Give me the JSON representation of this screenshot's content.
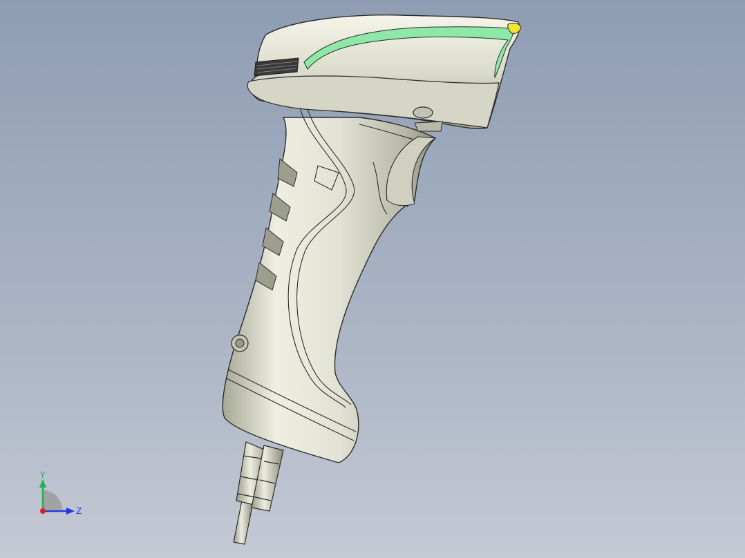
{
  "viewport": {
    "background_top": "#8f9db3",
    "background_bottom": "#c4c9d4"
  },
  "model": {
    "body_color": "#e6e6d8",
    "edge_color": "#2b2b2b",
    "accent_light_color": "#8ee8a8",
    "accent_yellow_color": "#f2e430"
  },
  "triad": {
    "y_label": "Y",
    "z_label": "Z",
    "y_color": "#22b14c",
    "z_color": "#2038d8",
    "x_color": "#d82020"
  }
}
